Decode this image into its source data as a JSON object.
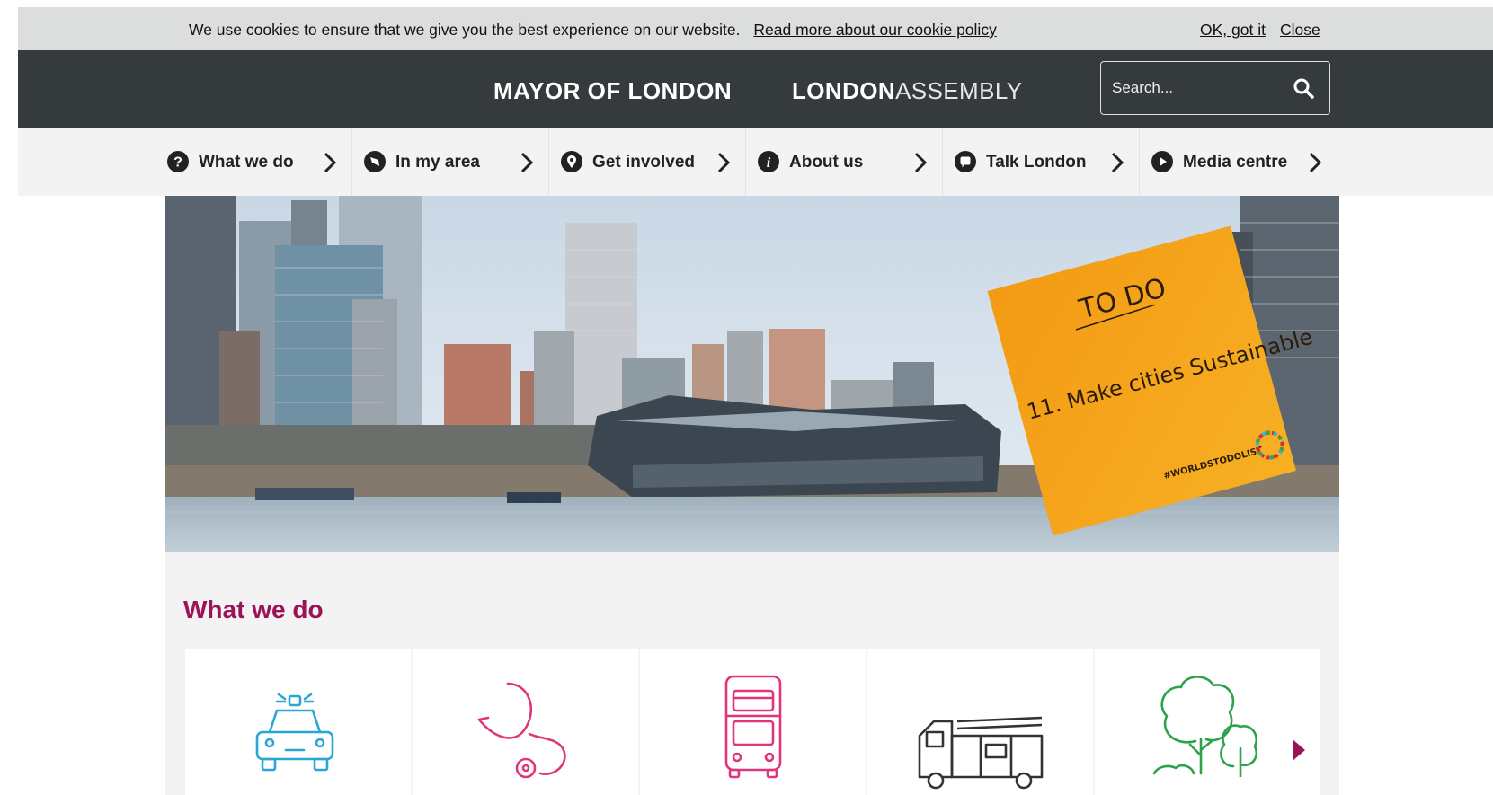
{
  "cookie": {
    "message": "We use cookies to ensure that we give you the best experience on our website.",
    "policy_link": "Read more about our cookie policy",
    "ok_label": "OK, got it",
    "close_label": "Close"
  },
  "header": {
    "mayor_logo": "MAYOR OF LONDON",
    "assembly_strong": "LONDON",
    "assembly_light": "ASSEMBLY",
    "search_placeholder": "Search...",
    "search_icon": "search-icon"
  },
  "nav": {
    "items": [
      {
        "label": "What we do",
        "icon": "question-circle-icon"
      },
      {
        "label": "In my area",
        "icon": "compass-icon"
      },
      {
        "label": "Get involved",
        "icon": "map-pin-icon"
      },
      {
        "label": "About us",
        "icon": "info-circle-icon"
      },
      {
        "label": "Talk London",
        "icon": "speech-bubble-icon"
      },
      {
        "label": "Media centre",
        "icon": "play-circle-icon"
      }
    ]
  },
  "hero": {
    "note_heading": "TO DO",
    "note_text": "11. Make cities Sustainable",
    "note_tag": "#WORLDSTODOLIST"
  },
  "what_we_do": {
    "title": "What we do",
    "cards": [
      {
        "icon": "police-car-icon"
      },
      {
        "icon": "stethoscope-icon"
      },
      {
        "icon": "bus-icon"
      },
      {
        "icon": "fire-engine-icon"
      },
      {
        "icon": "trees-icon"
      }
    ]
  },
  "colors": {
    "header_bg": "#353b3c",
    "cookie_bg": "#dcdddd",
    "nav_bg": "#f3f3f3",
    "accent_magenta": "#9b1457",
    "police_icon": "#2aa6d5",
    "health_icon": "#e0357a",
    "bus_icon": "#e0357a",
    "fire_icon": "#333333",
    "trees_icon": "#2ca24a",
    "note_orange": "#f9a51b"
  }
}
